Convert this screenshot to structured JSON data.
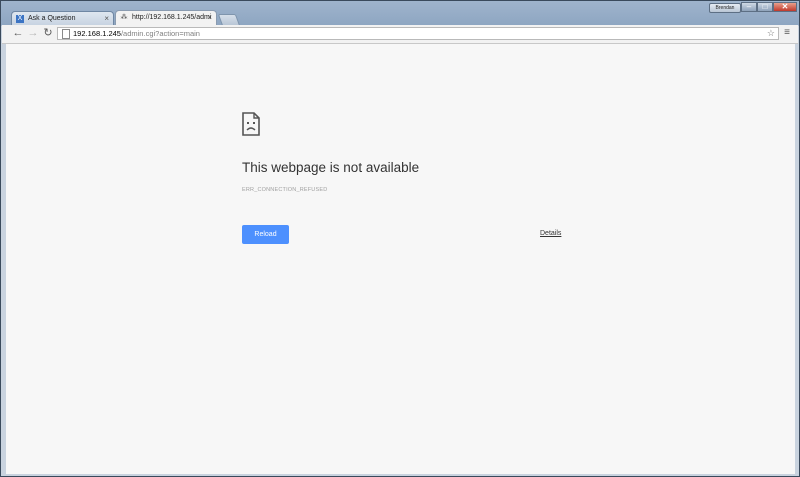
{
  "tabs": [
    {
      "label": "Ask a Question",
      "icon": "stackexchange-favicon-icon",
      "active": false,
      "close": "×"
    },
    {
      "label": "http://192.168.1.245/admi",
      "icon": "network-favicon-icon",
      "active": true,
      "close": "×"
    }
  ],
  "window": {
    "user_label": "Brendan",
    "minimize": "–",
    "maximize": "□",
    "close": "✕"
  },
  "toolbar": {
    "back": "←",
    "forward": "→",
    "reload": "↻",
    "url_host": "192.168.1.245",
    "url_rest": "/admin.cgi?action=main",
    "star": "☆",
    "menu": "≡"
  },
  "error_page": {
    "heading": "This webpage is not available",
    "error_code": "ERR_CONNECTION_REFUSED",
    "reload_label": "Reload",
    "details_label": "Details"
  },
  "colors": {
    "accent": "#4d90fe",
    "page_bg": "#f7f7f7"
  }
}
